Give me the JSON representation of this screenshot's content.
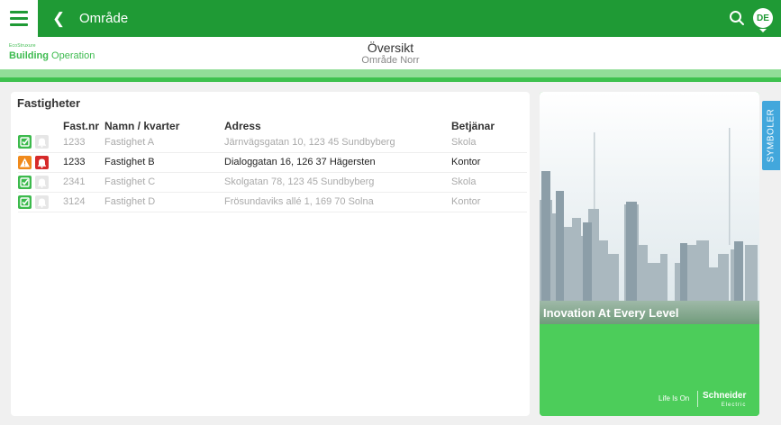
{
  "topbar": {
    "title": "Område",
    "avatar_initials": "DE"
  },
  "brand": {
    "small": "EcoStruxure",
    "bold": "Building",
    "light": " Operation"
  },
  "overview": {
    "title": "Översikt",
    "subtitle": "Område Norr"
  },
  "panel": {
    "title": "Fastigheter",
    "columns": [
      "Fast.nr",
      "Namn / kvarter",
      "Adress",
      "Betjänar"
    ],
    "rows": [
      {
        "status": "ok",
        "nr": "1233",
        "name": "Fastighet A",
        "address": "Järnvägsgatan 10, 123 45 Sundbyberg",
        "serves": "Skola"
      },
      {
        "status": "alarm",
        "nr": "1233",
        "name": "Fastighet B",
        "address": "Dialoggatan 16, 126 37 Hägersten",
        "serves": "Kontor"
      },
      {
        "status": "ok",
        "nr": "2341",
        "name": "Fastighet C",
        "address": "Skolgatan 78, 123 45 Sundbyberg",
        "serves": "Skola"
      },
      {
        "status": "ok",
        "nr": "3124",
        "name": "Fastighet D",
        "address": "Frösundaviks allé 1, 169 70 Solna",
        "serves": "Kontor"
      }
    ]
  },
  "ad": {
    "slogan": "Inovation At Every Level",
    "life": "Life Is On",
    "logo": "Schneider",
    "logo_sub": "Electric"
  },
  "side_tab": "SYMBOLER",
  "colors": {
    "primary": "#1f9a35",
    "accent": "#3fc14f",
    "warning": "#f08a1c",
    "alarm": "#d62a2a",
    "tab": "#42a7dc"
  }
}
